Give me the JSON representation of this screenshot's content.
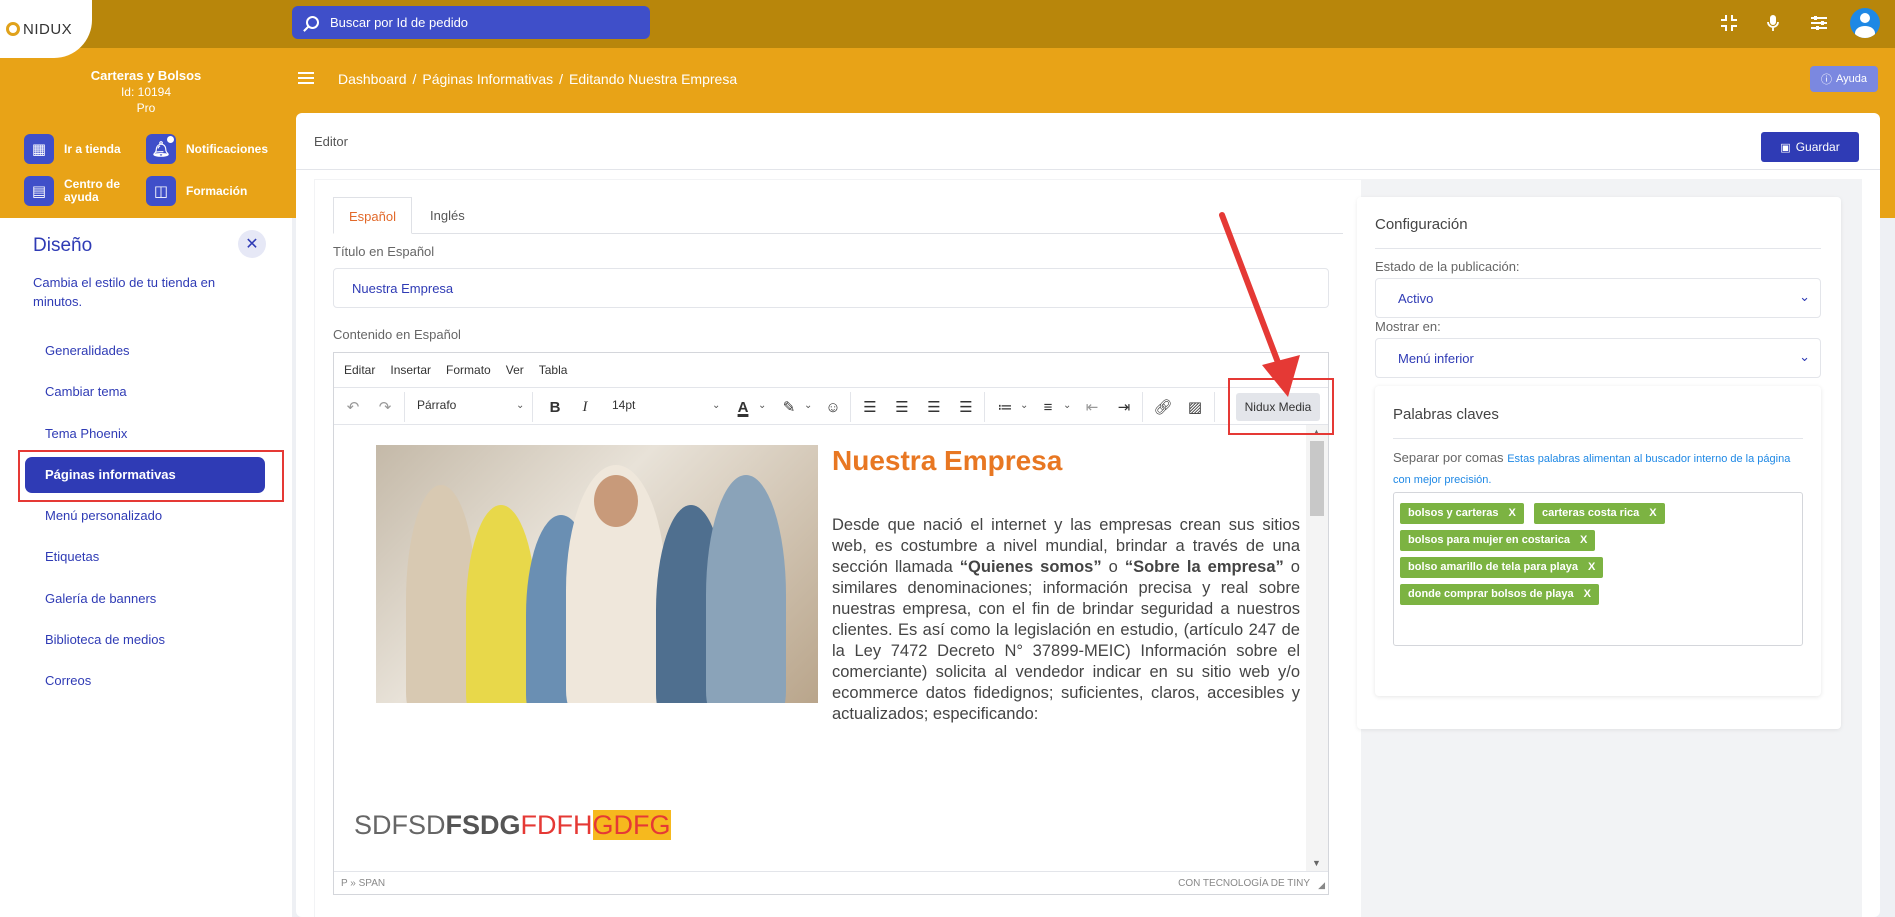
{
  "app": {
    "logo": "NIDUX"
  },
  "search": {
    "placeholder": "Buscar por Id de pedido"
  },
  "topbar_icons": [
    "compress-icon",
    "microphone-icon",
    "sliders-icon",
    "user-avatar-icon"
  ],
  "store": {
    "name": "Carteras y Bolsos",
    "id": "Id: 10194",
    "plan": "Pro"
  },
  "quick_links": {
    "store": "Ir a tienda",
    "notifications": "Notificaciones",
    "help_center": "Centro de ayuda",
    "training": "Formación"
  },
  "breadcrumb": {
    "items": [
      "Dashboard",
      "/",
      "Páginas Informativas",
      "/",
      "Editando Nuestra Empresa"
    ]
  },
  "help_button": "Ayuda",
  "sidebar": {
    "title": "Diseño",
    "description": "Cambia el estilo de tu tienda en minutos.",
    "items": [
      "Generalidades",
      "Cambiar tema",
      "Tema Phoenix",
      "Páginas informativas",
      "Menú personalizado",
      "Etiquetas",
      "Galería de banners",
      "Biblioteca de medios",
      "Correos"
    ],
    "active_index": 3
  },
  "main": {
    "label": "Editor",
    "save_label": "Guardar"
  },
  "tabs": [
    "Español",
    "Inglés"
  ],
  "form": {
    "title_label": "Título en Español",
    "title_value": "Nuestra Empresa",
    "content_label": "Contenido en Español"
  },
  "editor": {
    "menu": [
      "Editar",
      "Insertar",
      "Formato",
      "Ver",
      "Tabla"
    ],
    "block_format": "Párrafo",
    "font_size": "14pt",
    "custom_button": "Nidux Media",
    "heading": "Nuestra Empresa",
    "paragraph": {
      "p1": "Desde que nació el internet y las empresas crean sus sitios web, es costumbre a nivel mundial, brindar a través de una sección llamada ",
      "b1": "“Quienes somos”",
      "p2": " o ",
      "b2": "“Sobre la empresa”",
      "p3": " o similares denominaciones; información precisa y real sobre nuestras empresa, con el fin de brindar seguridad a nuestros clientes. Es así como la legislación en estudio, (artículo 247 de la Ley 7472  Decreto N° 37899-MEIC) Información sobre el comerciante) solicita al vendedor indicar en su sitio web y/o ecommerce datos fidedignos; suficientes, claros, accesibles y actualizados; especificando:"
    },
    "sample": {
      "normal": "SDFSD",
      "bold": "FSDG",
      "red": "FDFH",
      "highlight": "GDFG"
    },
    "status_left": "P » SPAN",
    "status_right": "CON TECNOLOGÍA DE TINY"
  },
  "config": {
    "title": "Configuración",
    "status_label": "Estado de la publicación:",
    "status_value": "Activo",
    "show_label": "Mostrar en:",
    "show_value": "Menú inferior"
  },
  "keywords": {
    "title": "Palabras claves",
    "separator": "Separar por comas",
    "hint": "Estas palabras alimentan al buscador interno de la página con mejor precisión.",
    "tags": [
      "bolsos y carteras",
      "carteras costa rica",
      "bolsos para mujer en costarica",
      "bolso amarillo de tela para playa",
      "donde comprar bolsos de playa"
    ],
    "remove": "X"
  },
  "colors": {
    "topbar": "#b8860b",
    "band": "#e8a317",
    "primary": "#2f3bb5",
    "accent": "#e87722",
    "tag": "#7cb342",
    "annotation": "#e53935"
  }
}
